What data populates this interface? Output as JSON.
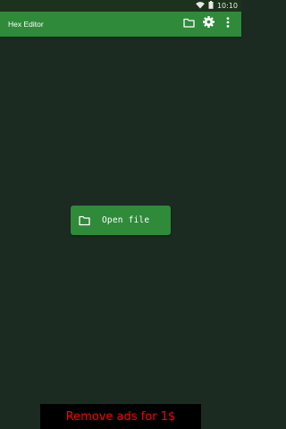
{
  "status_bar": {
    "time": "10:10",
    "icons": [
      "wifi-icon",
      "battery-icon"
    ]
  },
  "app_bar": {
    "title": "Hex Editor",
    "actions": [
      "folder-icon",
      "gear-icon",
      "more-vert-icon"
    ]
  },
  "main": {
    "open_file_label": "Open file",
    "open_file_icon": "folder-icon"
  },
  "ad": {
    "text": "Remove ads for 1$"
  },
  "colors": {
    "background": "#1c2b22",
    "status_bar": "#1d321d",
    "primary": "#2f8a3a",
    "ad_background": "#000000",
    "ad_text": "#ff0000"
  }
}
